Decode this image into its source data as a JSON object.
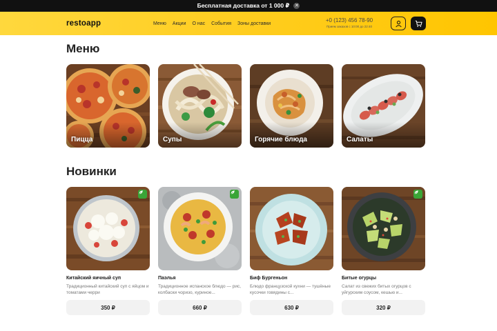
{
  "promo": {
    "text": "Бесплатная доставка от 1 000 ₽",
    "close_icon": "close-icon"
  },
  "header": {
    "logo": "restoapp",
    "nav": [
      "Меню",
      "Акции",
      "О нас",
      "События",
      "Зоны доставки"
    ],
    "phone": "+0 (123) 456 78-90",
    "hours": "Прием заказов с 10:00 до 22:40",
    "user_icon": "user-icon",
    "cart_icon": "cart-icon"
  },
  "colors": {
    "accent": "#ffcd1f",
    "dark": "#111111",
    "veg_badge": "#3aa537"
  },
  "menu": {
    "title": "Меню",
    "categories": [
      {
        "label": "Пицца"
      },
      {
        "label": "Супы"
      },
      {
        "label": "Горячие блюда"
      },
      {
        "label": "Салаты"
      }
    ]
  },
  "new_items": {
    "title": "Новинки",
    "products": [
      {
        "name": "Китайский яичный суп",
        "description": "Традиционный китайский суп с яйцом и томатами черри",
        "price": "350 ₽",
        "badge_icon": "leaf-icon"
      },
      {
        "name": "Паэлья",
        "description": "Традиционное испанское блюдо — рис, колбаски чоризо, куриное...",
        "price": "660 ₽"
      },
      {
        "name": "Биф Бургеньон",
        "description": "Блюдо французской кухни — тушёные кусочки говядины с...",
        "price": "630 ₽"
      },
      {
        "name": "Битые огурцы",
        "description": "Салат из свежих битых огурцов с уйгурским соусом, кешью и...",
        "price": "320 ₽",
        "badge_icon": "leaf-icon"
      }
    ]
  }
}
